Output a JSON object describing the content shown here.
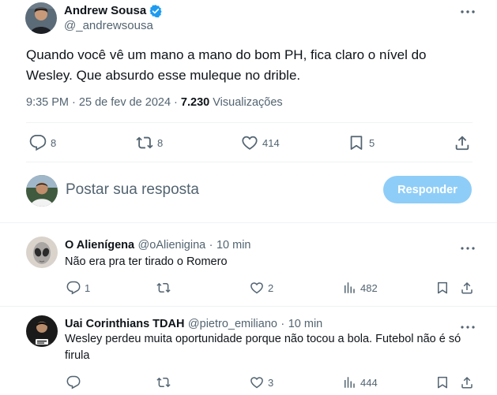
{
  "tweet": {
    "author_name": "Andrew Sousa",
    "author_handle": "@_andrewsousa",
    "text": "Quando você vê um mano a mano do bom PH, fica claro o nível do Wesley. Que absurdo esse muleque no drible.",
    "time": "9:35 PM",
    "separator": "·",
    "date": "25 de fev de 2024",
    "views_count": "7.230",
    "views_label": "Visualizações",
    "stats": {
      "replies": "8",
      "reposts": "8",
      "likes": "414",
      "bookmarks": "5"
    }
  },
  "composer": {
    "placeholder": "Postar sua resposta",
    "button_label": "Responder"
  },
  "replies": [
    {
      "name": "O Alienígena",
      "handle": "@oAlienigina",
      "separator": "·",
      "time": "10 min",
      "text": "Não era pra ter tirado o Romero",
      "stats": {
        "replies": "1",
        "reposts": "",
        "likes": "2",
        "views": "482"
      }
    },
    {
      "name": "Uai Corinthians TDAH",
      "handle": "@pietro_emiliano",
      "separator": "·",
      "time": "10 min",
      "text": "Wesley perdeu muita oportunidade porque não tocou a bola. Futebol não é só firula",
      "stats": {
        "replies": "",
        "reposts": "",
        "likes": "3",
        "views": "444"
      }
    }
  ],
  "colors": {
    "accent": "#1d9bf0",
    "button_disabled": "#8ecdf8",
    "muted_text": "#536471",
    "divider": "#eff3f4"
  },
  "icons": [
    "more-icon",
    "verified-badge-icon",
    "reply-icon",
    "repost-icon",
    "like-icon",
    "bookmark-icon",
    "share-icon",
    "views-icon"
  ]
}
